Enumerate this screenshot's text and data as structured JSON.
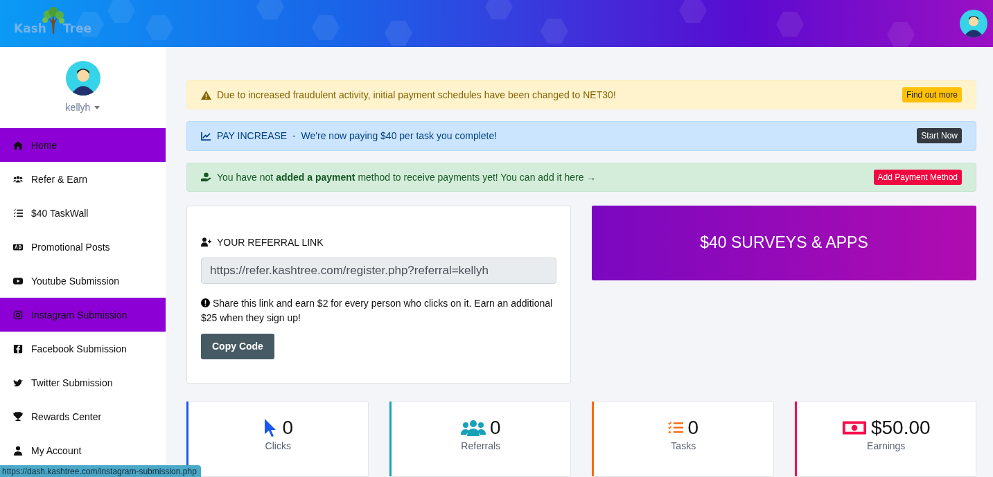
{
  "header": {
    "logo": [
      "Kash",
      "Tree"
    ]
  },
  "sidebar": {
    "username": "kellyh",
    "items": [
      {
        "label": "Home",
        "kind": "home",
        "selected": true
      },
      {
        "label": "Refer & Earn",
        "kind": "users",
        "selected": false
      },
      {
        "label": "$40 TaskWall",
        "kind": "tasks",
        "selected": false
      },
      {
        "label": "Promotional Posts",
        "kind": "ad",
        "selected": false
      },
      {
        "label": "Youtube Submission",
        "kind": "youtube",
        "selected": false
      },
      {
        "label": "Instagram Submission",
        "kind": "instagram",
        "selected": true
      },
      {
        "label": "Facebook Submission",
        "kind": "facebook",
        "selected": false
      },
      {
        "label": "Twitter Submission",
        "kind": "twitter",
        "selected": false
      },
      {
        "label": "Rewards Center",
        "kind": "trophy",
        "selected": false
      },
      {
        "label": "My Account",
        "kind": "account",
        "selected": false
      }
    ]
  },
  "alerts": [
    {
      "kind": "warning",
      "text": "Due to increased fraudulent activity, initial payment schedules have been changed to NET30!",
      "button": "Find out more"
    },
    {
      "kind": "info",
      "prefix": "PAY INCREASE  -",
      "text": "We're now paying $40 per task you complete!",
      "button": "Start Now"
    },
    {
      "kind": "success",
      "text": "You have not **added a payment** method to receive payments yet! You can add it here →",
      "button": "Add Payment Method"
    }
  ],
  "referral": {
    "title": "YOUR REFERRAL LINK",
    "link": "https://refer.kashtree.com/register.php?referral=kellyh",
    "note": "Share this link and earn $2 for every person who clicks on it. Earn an additional $25 when they sign up!",
    "button": "Copy Code"
  },
  "banner": {
    "label": "$40 SURVEYS & APPS"
  },
  "stats": [
    {
      "kind": "clicks",
      "value": "0",
      "label": "Clicks",
      "color": "#1a56f0"
    },
    {
      "kind": "referrals",
      "value": "0",
      "label": "Referrals",
      "color": "#17a2b8"
    },
    {
      "kind": "tasks",
      "value": "0",
      "label": "Tasks",
      "color": "#fd6a0c"
    },
    {
      "kind": "earnings",
      "value": "$50.00",
      "label": "Earnings",
      "color": "#f5104e"
    }
  ],
  "status_bar": {
    "url": "https://dash.kashtree.com/instagram-submission.php"
  }
}
